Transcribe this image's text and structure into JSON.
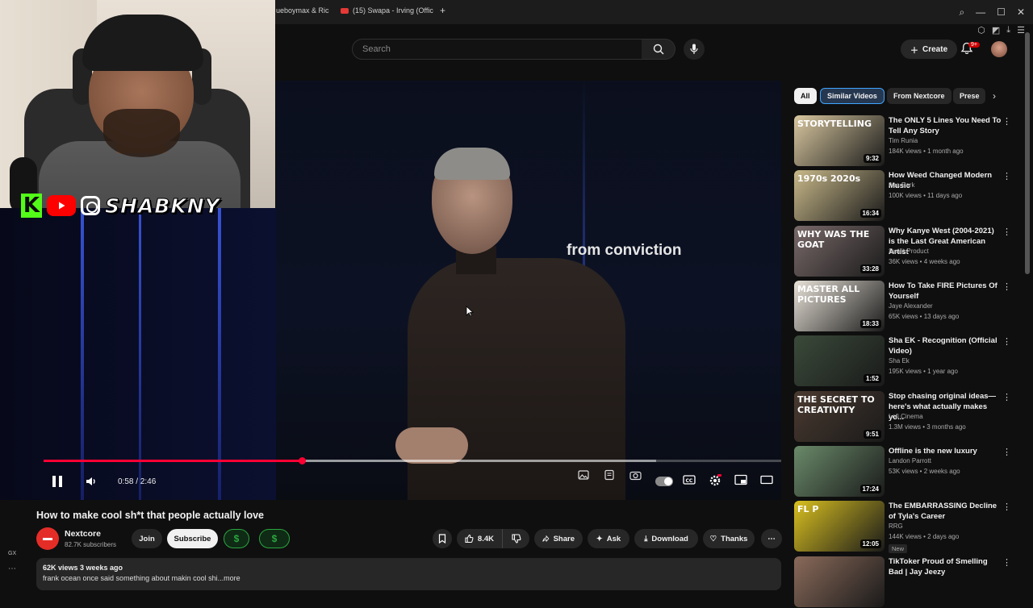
{
  "browser": {
    "tabs": [
      {
        "label": "ueboymax & Ric"
      },
      {
        "label": "(15) Swapa - Irving (Offic"
      }
    ],
    "new_tab": "+"
  },
  "header": {
    "search_placeholder": "Search",
    "create_label": "Create",
    "notifications_badge": "9+"
  },
  "webcam": {
    "handle": "SHABKNY",
    "kick_letter": "K"
  },
  "player": {
    "overlay_text": "from conviction",
    "time": "0:58 / 2:46",
    "progress": 0.35,
    "buffered": 0.83
  },
  "video": {
    "title": "How to make cool sh*t that people actually love",
    "channel": "Nextcore",
    "subscribers": "82.7K subscribers",
    "join_label": "Join",
    "subscribe_label": "Subscribe",
    "likes": "8.4K",
    "share_label": "Share",
    "ask_label": "Ask",
    "download_label": "Download",
    "thanks_label": "Thanks",
    "views": "62K views  3 weeks ago",
    "description": "frank ocean once said something about makin cool shi...more"
  },
  "sidebar_left": {
    "gx": "GX"
  },
  "chips": [
    "All",
    "Similar Videos",
    "From Nextcore",
    "Prese"
  ],
  "recommendations": [
    {
      "title": "The ONLY 5 Lines You Need To Tell Any Story",
      "channel": "Tim Runia",
      "meta": "184K views • 1 month ago",
      "duration": "9:32",
      "thumb_text": "STORYTELLING",
      "thumb_color": "#d9c8a0"
    },
    {
      "title": "How Weed Changed Modern Music",
      "channel": "Asa Park",
      "meta": "100K views • 11 days ago",
      "duration": "16:34",
      "thumb_text": "1970s 2020s",
      "thumb_color": "#c9b98a"
    },
    {
      "title": "Why Kanye West (2004-2021) is the Last Great American Artist",
      "channel": "Sunlit Product",
      "meta": "36K views • 4 weeks ago",
      "duration": "33:28",
      "thumb_text": "WHY WAS THE GOAT",
      "thumb_color": "#7a6a6a"
    },
    {
      "title": "How To Take FIRE Pictures Of Yourself",
      "channel": "Jaye Alexander",
      "meta": "65K views • 13 days ago",
      "duration": "18:33",
      "thumb_text": "MASTER ALL PICTURES",
      "thumb_color": "#e8e2d8"
    },
    {
      "title": "Sha EK - Recognition (Official Video)",
      "channel": "Sha Ek",
      "meta": "195K views • 1 year ago",
      "duration": "1:52",
      "thumb_text": "",
      "thumb_color": "#3a4a3a"
    },
    {
      "title": "Stop chasing original ideas—here's what actually makes yo...",
      "channel": "Lofi Cinema",
      "meta": "1.3M views • 3 months ago",
      "duration": "9:51",
      "thumb_text": "THE SECRET TO CREATIVITY",
      "thumb_color": "#4a3a30"
    },
    {
      "title": "Offline is the new luxury",
      "channel": "Landon Parrott",
      "meta": "53K views • 2 weeks ago",
      "duration": "17:24",
      "thumb_text": "",
      "thumb_color": "#6a8a6a"
    },
    {
      "title": "The EMBARRASSING Decline of Tyla's Career",
      "channel": "RRG",
      "meta": "144K views • 2 days ago",
      "duration": "12:05",
      "thumb_text": "FL  P",
      "thumb_color": "#d8c020",
      "badge": "New"
    },
    {
      "title": "TikToker Proud of Smelling Bad | Jay Jeezy",
      "channel": "",
      "meta": "",
      "duration": "",
      "thumb_text": "",
      "thumb_color": "#8a6a5a"
    }
  ]
}
